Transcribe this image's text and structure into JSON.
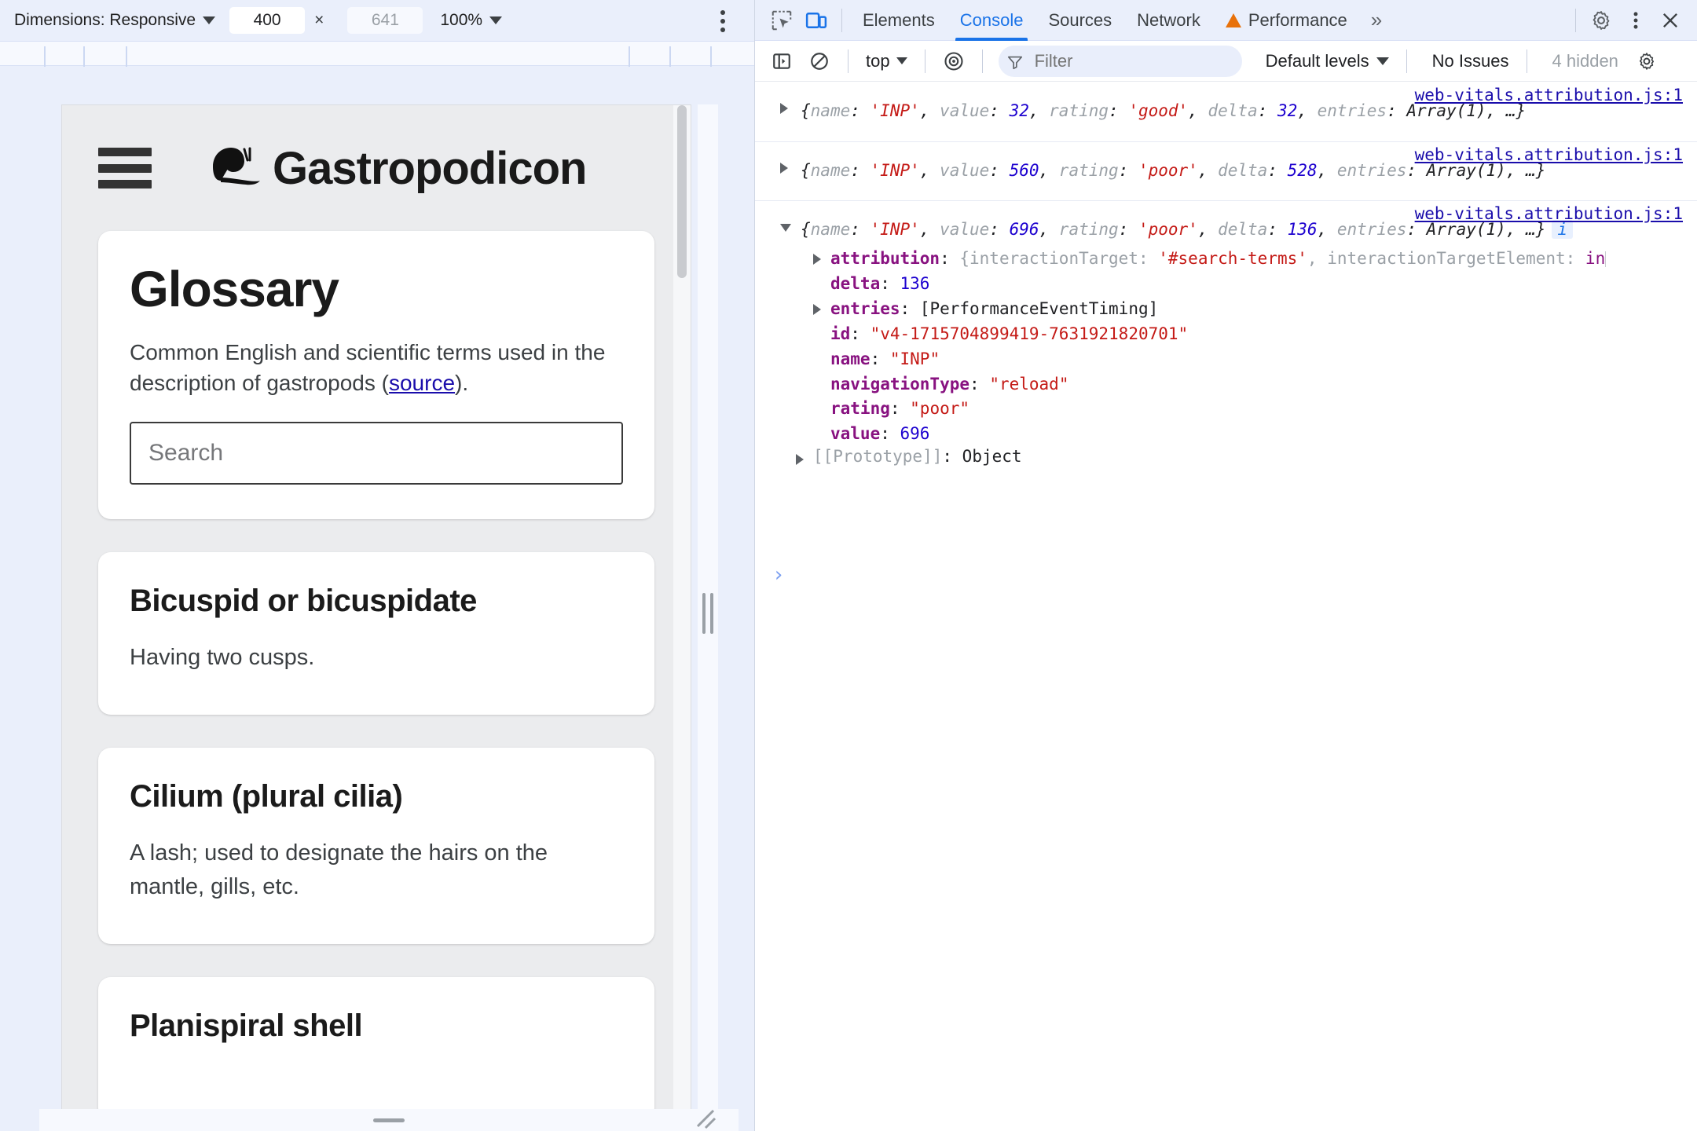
{
  "device_toolbar": {
    "dimensions_label": "Dimensions: Responsive",
    "width_value": "400",
    "height_value": "641",
    "separator": "×",
    "zoom_label": "100%",
    "kebab_name": "more-options"
  },
  "page": {
    "brand": "Gastropodicon",
    "snail_icon": "snail-icon",
    "menu_icon": "hamburger-menu-icon",
    "glossary": {
      "title": "Glossary",
      "description_before": "Common English and scientific terms used in the description of gastropods (",
      "source_link": "source",
      "description_after": ").",
      "search_placeholder": "Search"
    },
    "terms": [
      {
        "term": "Bicuspid or bicuspidate",
        "definition": "Having two cusps."
      },
      {
        "term": "Cilium (plural cilia)",
        "definition": "A lash; used to designate the hairs on the mantle, gills, etc."
      },
      {
        "term": "Planispiral shell",
        "definition": ""
      }
    ]
  },
  "devtools": {
    "tabs": [
      {
        "label": "Elements",
        "active": false,
        "warning": false
      },
      {
        "label": "Console",
        "active": true,
        "warning": false
      },
      {
        "label": "Sources",
        "active": false,
        "warning": false
      },
      {
        "label": "Network",
        "active": false,
        "warning": false
      },
      {
        "label": "Performance",
        "active": false,
        "warning": true
      }
    ],
    "more_tabs": "»",
    "icons": {
      "inspect": "inspect-element-icon",
      "device": "device-toolbar-icon",
      "settings": "gear-icon",
      "menu": "kebab-menu-icon",
      "close": "close-icon"
    },
    "console_toolbar": {
      "sidebar_toggle": "console-sidebar-icon",
      "clear": "clear-console-icon",
      "context": "top",
      "eye": "live-expression-icon",
      "filter_placeholder": "Filter",
      "filter_icon": "funnel-icon",
      "levels": "Default levels",
      "issues": "No Issues",
      "hidden": "4 hidden",
      "settings_icon": "console-settings-gear-icon"
    },
    "console_logs": [
      {
        "source": "web-vitals.attribution.js:1",
        "expanded": false,
        "summary": {
          "name_key": "name",
          "name_val": "'INP'",
          "value_key": "value",
          "value_val": "32",
          "rating_key": "rating",
          "rating_val": "'good'",
          "delta_key": "delta",
          "delta_val": "32",
          "entries_key": "entries",
          "entries_val": "Array(1)",
          "ellipsis": ", …}"
        }
      },
      {
        "source": "web-vitals.attribution.js:1",
        "expanded": false,
        "summary": {
          "name_key": "name",
          "name_val": "'INP'",
          "value_key": "value",
          "value_val": "560",
          "rating_key": "rating",
          "rating_val": "'poor'",
          "delta_key": "delta",
          "delta_val": "528",
          "entries_key": "entries",
          "entries_val": "Array(1)",
          "ellipsis": ", …}"
        }
      },
      {
        "source": "web-vitals.attribution.js:1",
        "expanded": true,
        "info_badge": "i",
        "summary": {
          "name_key": "name",
          "name_val": "'INP'",
          "value_key": "value",
          "value_val": "696",
          "rating_key": "rating",
          "rating_val": "'poor'",
          "delta_key": "delta",
          "delta_val": "136",
          "entries_key": "entries",
          "entries_val": "Array(1)",
          "ellipsis": ", …}"
        },
        "properties": [
          {
            "expandable": true,
            "key": "attribution",
            "value_parts": [
              {
                "t": "{interactionTarget: ",
                "c": "gray"
              },
              {
                "t": "'#search-terms'",
                "c": "str"
              },
              {
                "t": ", interactionTargetElement: ",
                "c": "gray"
              },
              {
                "t": "in",
                "c": "key"
              }
            ]
          },
          {
            "expandable": false,
            "key": "delta",
            "value": "136",
            "vtype": "num"
          },
          {
            "expandable": true,
            "key": "entries",
            "value": "[PerformanceEventTiming]",
            "vtype": "plain"
          },
          {
            "expandable": false,
            "key": "id",
            "value": "\"v4-1715704899419-7631921820701\"",
            "vtype": "str"
          },
          {
            "expandable": false,
            "key": "name",
            "value": "\"INP\"",
            "vtype": "str"
          },
          {
            "expandable": false,
            "key": "navigationType",
            "value": "\"reload\"",
            "vtype": "str"
          },
          {
            "expandable": false,
            "key": "rating",
            "value": "\"poor\"",
            "vtype": "str"
          },
          {
            "expandable": false,
            "key": "value",
            "value": "696",
            "vtype": "num"
          }
        ],
        "prototype": {
          "key": "[[Prototype]]",
          "value": "Object"
        }
      }
    ],
    "prompt_symbol": "›"
  }
}
